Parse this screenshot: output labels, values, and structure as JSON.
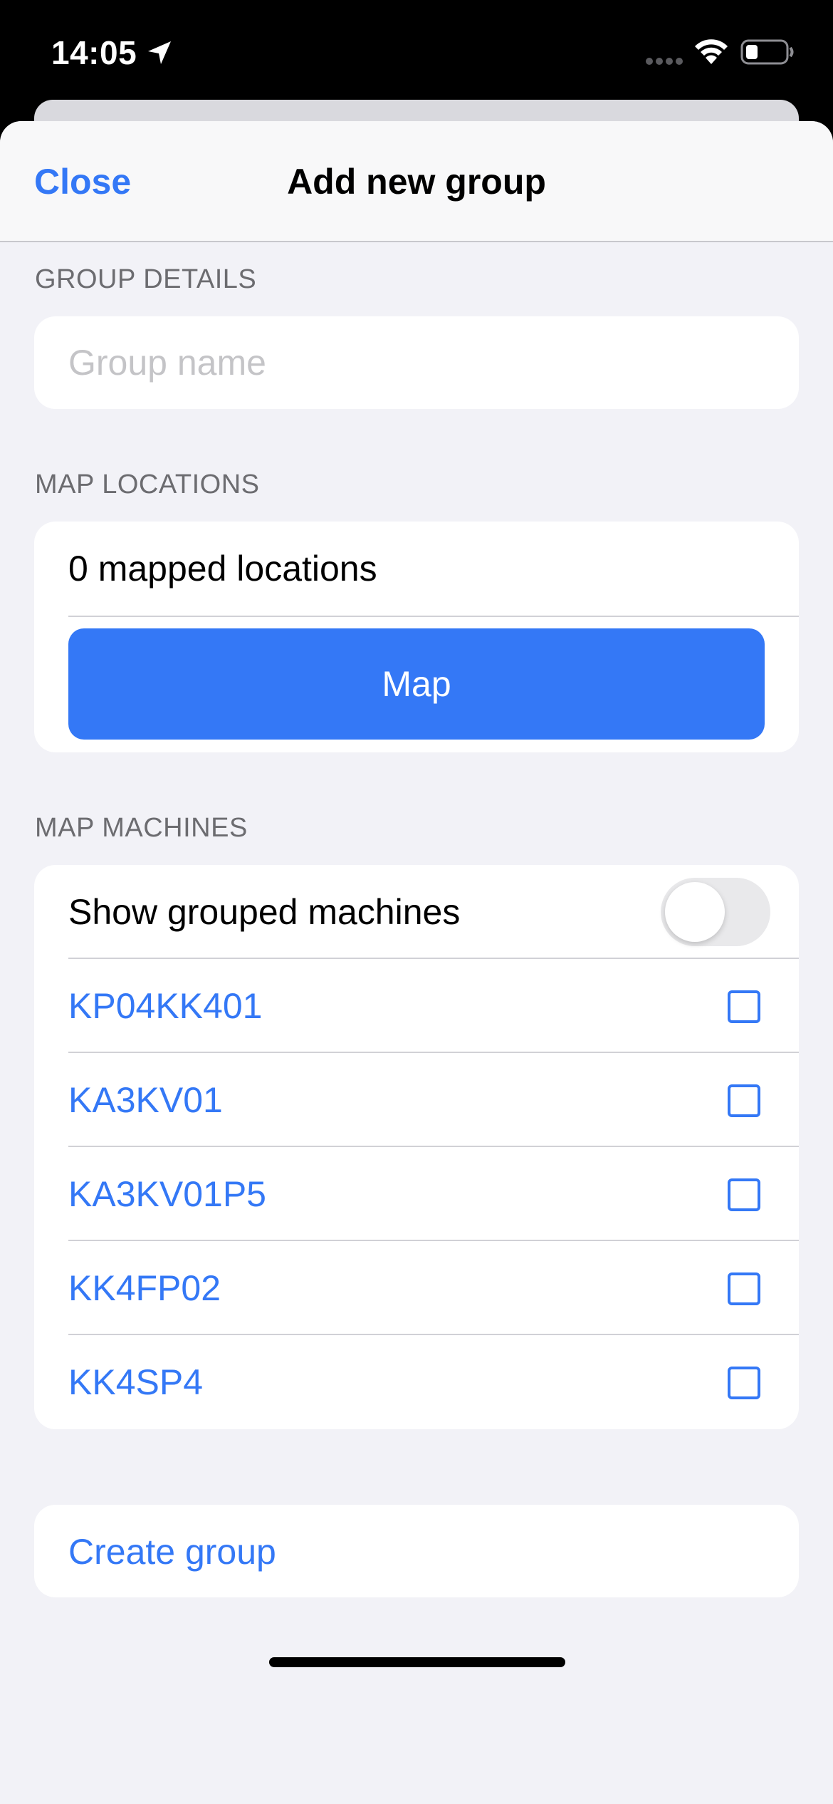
{
  "status_bar": {
    "time": "14:05",
    "icons": [
      "location-arrow-icon",
      "signal-dots-icon",
      "wifi-icon",
      "battery-icon"
    ]
  },
  "nav": {
    "close_label": "Close",
    "title": "Add new group"
  },
  "group_details": {
    "header": "GROUP DETAILS",
    "name_value": "",
    "name_placeholder": "Group name"
  },
  "map_locations": {
    "header": "MAP LOCATIONS",
    "count_text": "0 mapped locations",
    "map_button_label": "Map"
  },
  "map_machines": {
    "header": "MAP MACHINES",
    "show_grouped_label": "Show grouped machines",
    "show_grouped_on": false,
    "machines": [
      {
        "label": "KP04KK401",
        "checked": false
      },
      {
        "label": "KA3KV01",
        "checked": false
      },
      {
        "label": "KA3KV01P5",
        "checked": false
      },
      {
        "label": "KK4FP02",
        "checked": false
      },
      {
        "label": "KK4SP4",
        "checked": false
      }
    ]
  },
  "actions": {
    "create_group_label": "Create group"
  },
  "colors": {
    "accent": "#3478f6",
    "background": "#f2f2f7",
    "card": "#ffffff",
    "secondary_text": "#6c6c70",
    "placeholder": "#c4c4c7"
  }
}
